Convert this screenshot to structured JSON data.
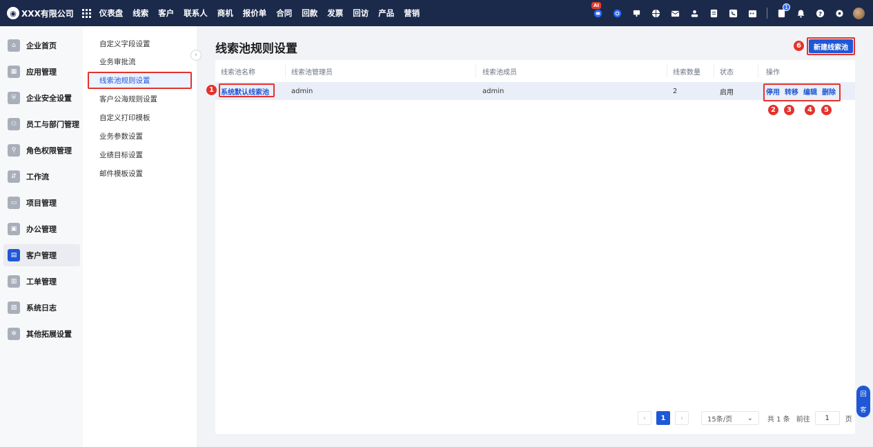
{
  "topbar": {
    "company": "XXX有限公司",
    "menu": [
      "仪表盘",
      "线索",
      "客户",
      "联系人",
      "商机",
      "报价单",
      "合同",
      "回款",
      "发票",
      "回访",
      "产品",
      "营销"
    ],
    "ai_badge": "AI",
    "notification_count": "1"
  },
  "sidebar": {
    "items": [
      {
        "label": "企业首页",
        "icon": "home-icon"
      },
      {
        "label": "应用管理",
        "icon": "apps-icon"
      },
      {
        "label": "企业安全设置",
        "icon": "shield-icon"
      },
      {
        "label": "员工与部门管理",
        "icon": "users-icon"
      },
      {
        "label": "角色权限管理",
        "icon": "user-role-icon"
      },
      {
        "label": "工作流",
        "icon": "workflow-icon"
      },
      {
        "label": "项目管理",
        "icon": "folder-icon"
      },
      {
        "label": "办公管理",
        "icon": "briefcase-icon"
      },
      {
        "label": "客户管理",
        "icon": "customer-icon"
      },
      {
        "label": "工单管理",
        "icon": "ticket-icon"
      },
      {
        "label": "系统日志",
        "icon": "log-icon"
      },
      {
        "label": "其他拓展设置",
        "icon": "settings-icon"
      }
    ],
    "active_index": 8
  },
  "submenu": {
    "items": [
      "自定义字段设置",
      "业务审批流",
      "线索池规则设置",
      "客户公海规则设置",
      "自定义打印模板",
      "业务参数设置",
      "业绩目标设置",
      "邮件模板设置"
    ],
    "active_index": 2
  },
  "main": {
    "title": "线索池规则设置",
    "new_button": "新建线索池",
    "table": {
      "headers": [
        "线索池名称",
        "线索池管理员",
        "线索池成员",
        "线索数量",
        "状态",
        "操作"
      ],
      "rows": [
        {
          "name": "系统默认线索池",
          "admin": "admin",
          "members": "admin",
          "count": "2",
          "status": "启用",
          "ops": [
            "停用",
            "转移",
            "编辑",
            "删除"
          ]
        }
      ]
    },
    "pagination": {
      "current_page": "1",
      "page_size": "15条/页",
      "total": "共 1 条",
      "goto_label": "前往",
      "goto_value": "1",
      "page_suffix": "页"
    }
  },
  "annotations": [
    "1",
    "2",
    "3",
    "4",
    "5",
    "6"
  ],
  "floating": {
    "top": "回",
    "bottom": "客"
  },
  "colors": {
    "primary": "#1f57d6",
    "topbar": "#1b2a4b",
    "annotation": "#e4322b",
    "row_highlight": "#e9eef8"
  }
}
